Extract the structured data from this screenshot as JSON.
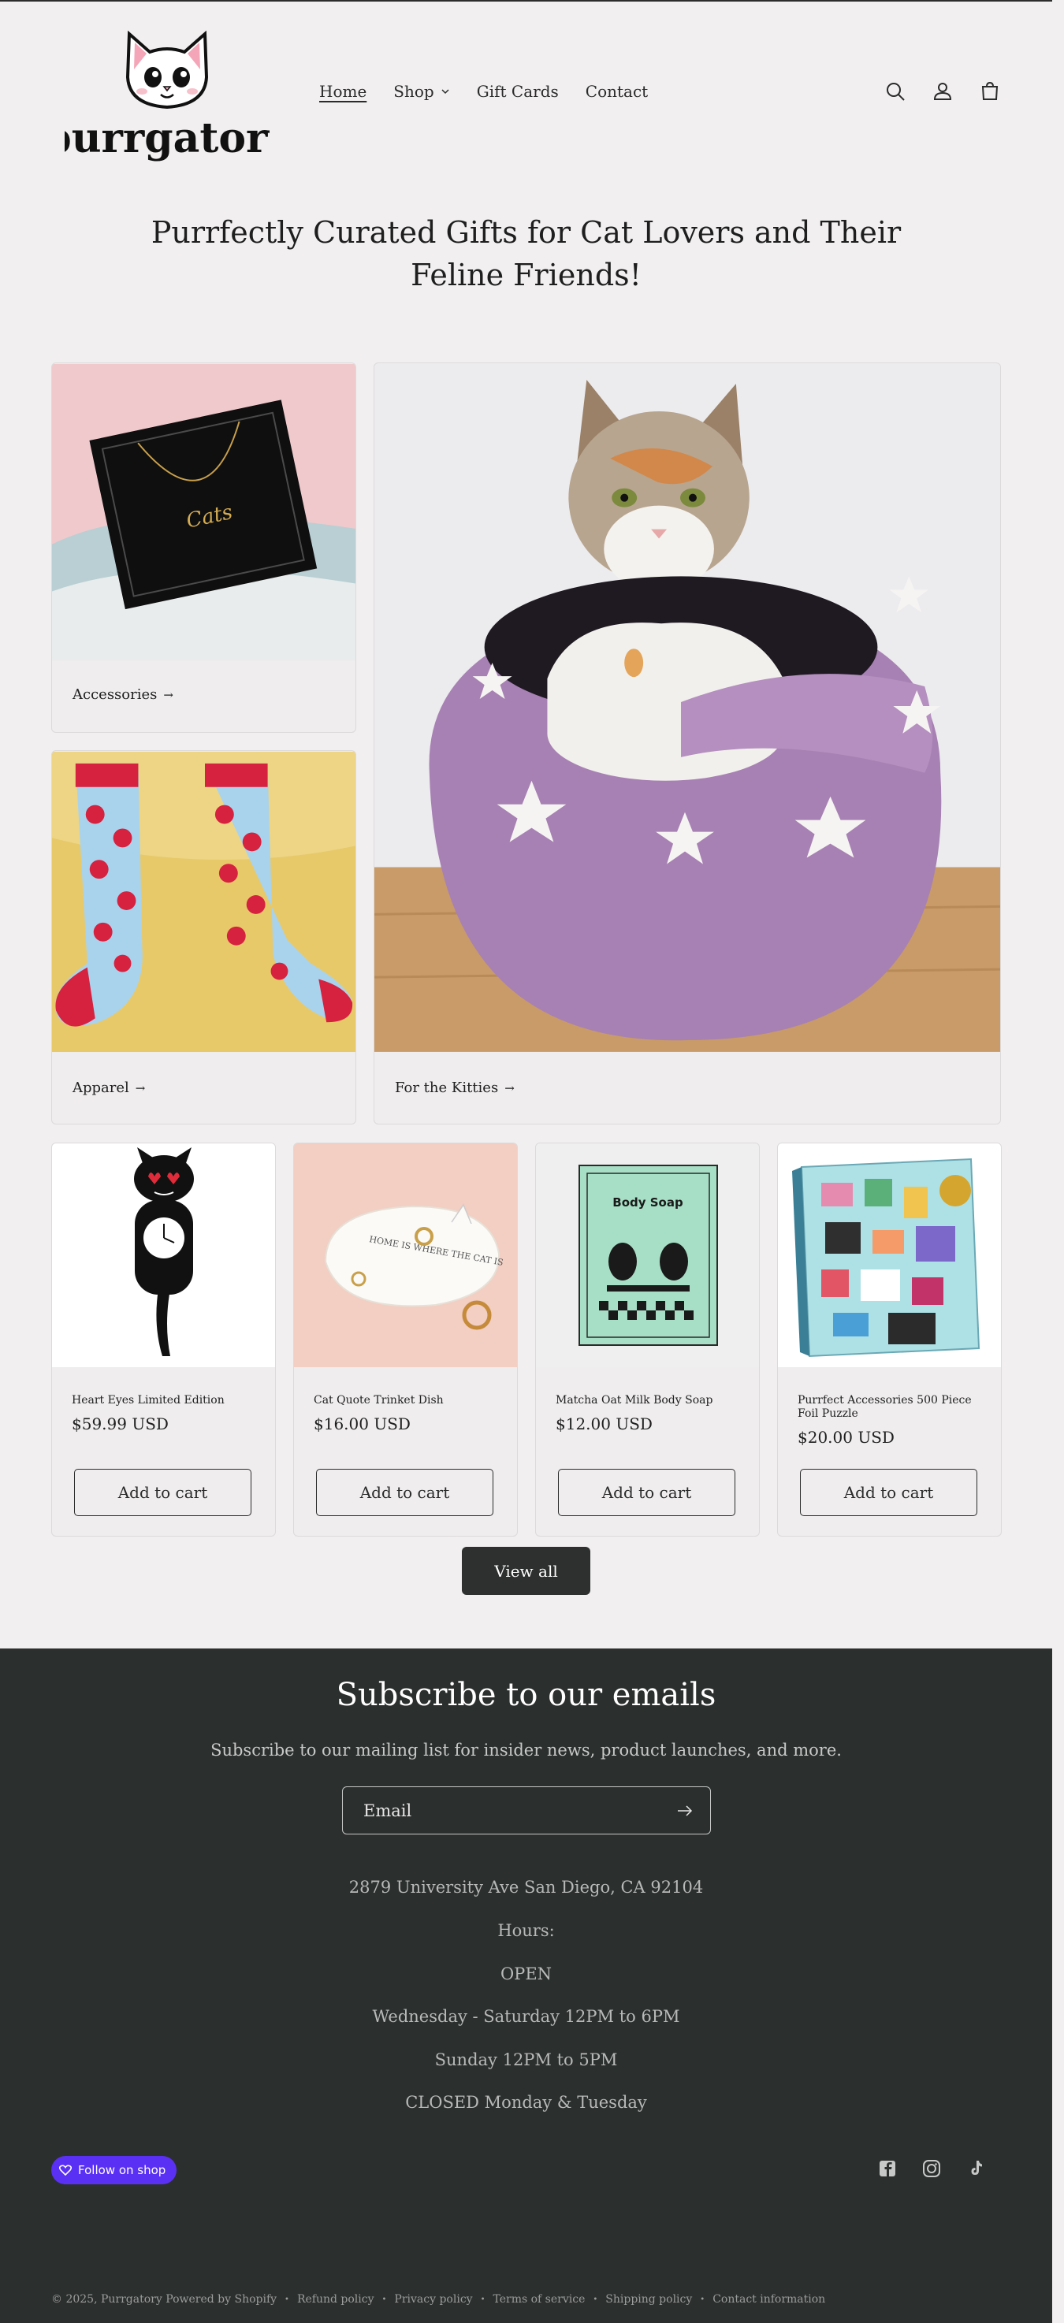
{
  "header": {
    "brand": "purrgatory",
    "nav": [
      {
        "label": "Home",
        "active": true
      },
      {
        "label": "Shop",
        "has_dropdown": true
      },
      {
        "label": "Gift Cards"
      },
      {
        "label": "Contact"
      }
    ],
    "icons": [
      "search-icon",
      "account-icon",
      "cart-icon"
    ]
  },
  "hero": {
    "title": "Purrfectly Curated Gifts for Cat Lovers and Their Feline Friends!"
  },
  "collections": [
    {
      "label": "Accessories",
      "arrow": "→"
    },
    {
      "label": "Apparel",
      "arrow": "→"
    },
    {
      "label": "For the Kitties",
      "arrow": "→"
    }
  ],
  "products": [
    {
      "title": "Heart Eyes Limited Edition",
      "price": "$59.99 USD",
      "button": "Add to cart"
    },
    {
      "title": "Cat Quote Trinket Dish",
      "price": "$16.00 USD",
      "button": "Add to cart"
    },
    {
      "title": "Matcha Oat Milk Body Soap",
      "price": "$12.00 USD",
      "button": "Add to cart"
    },
    {
      "title": "Purrfect Accessories 500 Piece Foil Puzzle",
      "price": "$20.00 USD",
      "button": "Add to cart"
    }
  ],
  "product_image_text": {
    "dish_quote": "HOME IS WHERE THE CAT IS",
    "soap_name": "Body Soap"
  },
  "view_all": "View all",
  "footer": {
    "subscribe_title": "Subscribe to our emails",
    "subscribe_text": "Subscribe to our mailing list for insider news, product launches, and more.",
    "email_placeholder": "Email",
    "info": [
      "2879 University Ave San Diego, CA 92104",
      "Hours:",
      "OPEN",
      "Wednesday - Saturday 12PM to 6PM",
      "Sunday 12PM to 5PM",
      "CLOSED Monday & Tuesday"
    ],
    "follow_shop": "Follow on shop",
    "social": [
      "facebook-icon",
      "instagram-icon",
      "tiktok-icon"
    ],
    "copyright": "© 2025, Purrgatory Powered by Shopify",
    "policies": [
      "Refund policy",
      "Privacy policy",
      "Terms of service",
      "Shipping policy",
      "Contact information"
    ]
  },
  "colors": {
    "page_bg": "#f1eff0",
    "footer_bg": "#2b2f2d",
    "button_dark": "#2d302e",
    "shop_purple": "#5a31f4"
  }
}
